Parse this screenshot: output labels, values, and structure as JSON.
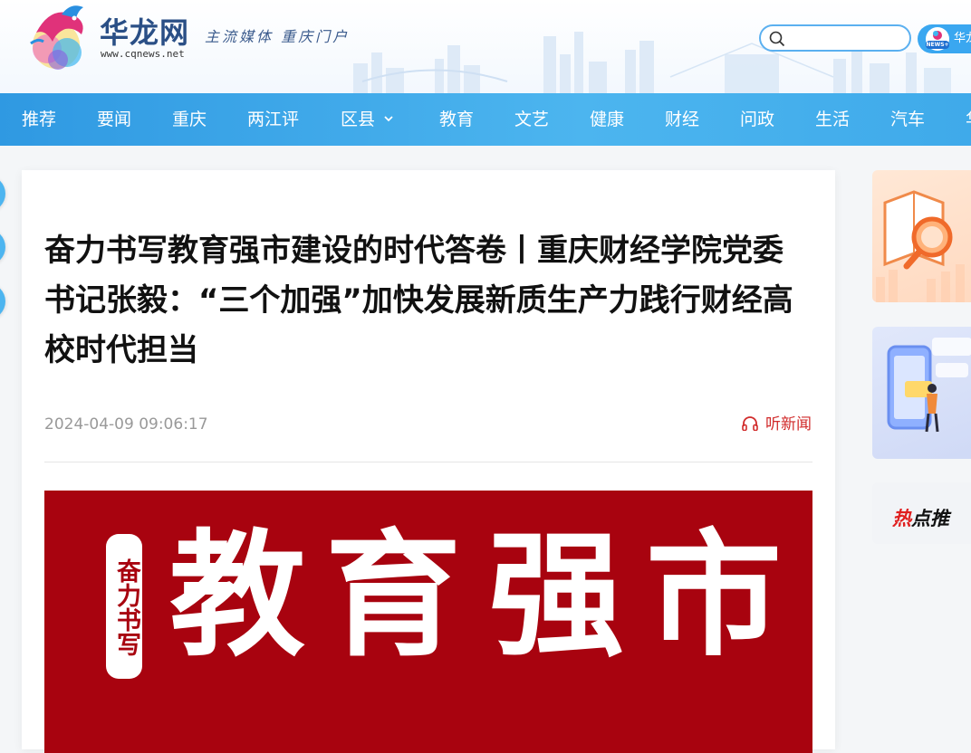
{
  "header": {
    "logo_text": "华龙网",
    "logo_url": "www.cqnews.net",
    "slogan": "主流媒体  重庆门户",
    "search": {
      "placeholder": ""
    },
    "app_label": "华龙",
    "app_badge": "NEWS+"
  },
  "nav": {
    "items": [
      {
        "label": "推荐"
      },
      {
        "label": "要闻"
      },
      {
        "label": "重庆"
      },
      {
        "label": "两江评"
      },
      {
        "label": "区县",
        "has_dropdown": true
      },
      {
        "label": "教育"
      },
      {
        "label": "文艺"
      },
      {
        "label": "健康"
      },
      {
        "label": "财经"
      },
      {
        "label": "问政"
      },
      {
        "label": "生活"
      },
      {
        "label": "汽车"
      },
      {
        "label": "华"
      }
    ]
  },
  "article": {
    "title": "奋力书写教育强市建设的时代答卷丨重庆财经学院党委书记张毅：“三个加强”加快发展新质生产力践行财经高校时代担当",
    "date": "2024-04-09 09:06:17",
    "listen_label": "听新闻",
    "banner": {
      "seal_text": "奋力书写",
      "headline_chars": [
        "教",
        "育",
        "强",
        "市"
      ]
    }
  },
  "sidebar": {
    "hot_label_first": "热",
    "hot_label_rest": "点推"
  },
  "colors": {
    "nav_bg": "#3aa7ea",
    "banner_red": "#a8030f",
    "listen_red": "#d12b2b",
    "accent_blue": "#5bb0f0"
  },
  "icons": [
    "logo-icon",
    "search-icon",
    "app-icon",
    "chevron-down-icon",
    "headphones-icon",
    "book-magnifier-icon",
    "phone-person-icon"
  ]
}
